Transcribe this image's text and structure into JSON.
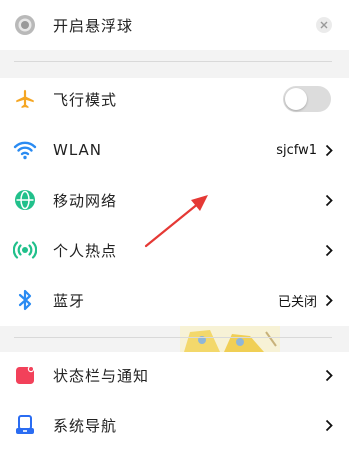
{
  "floating_ball": {
    "label": "开启悬浮球",
    "close_icon": "close-icon"
  },
  "items": [
    {
      "label": "飞行模式",
      "icon": "airplane-icon",
      "accent": "#f5a623",
      "toggle_on": false
    },
    {
      "label": "WLAN",
      "icon": "wifi-icon",
      "accent": "#2a8bf2",
      "value": "sjcfw1"
    },
    {
      "label": "移动网络",
      "icon": "globe-icon",
      "accent": "#21c08b"
    },
    {
      "label": "个人热点",
      "icon": "hotspot-icon",
      "accent": "#21c08b"
    },
    {
      "label": "蓝牙",
      "icon": "bluetooth-icon",
      "accent": "#2a8bf2",
      "value": "已关闭"
    },
    {
      "label": "状态栏与通知",
      "icon": "notification-icon",
      "accent": "#f2415a"
    },
    {
      "label": "系统导航",
      "icon": "navigation-icon",
      "accent": "#2a6cf2"
    }
  ],
  "colors": {
    "arrow": "#e53935",
    "divider": "#d9d9d9",
    "band": "#f3f3f3"
  }
}
